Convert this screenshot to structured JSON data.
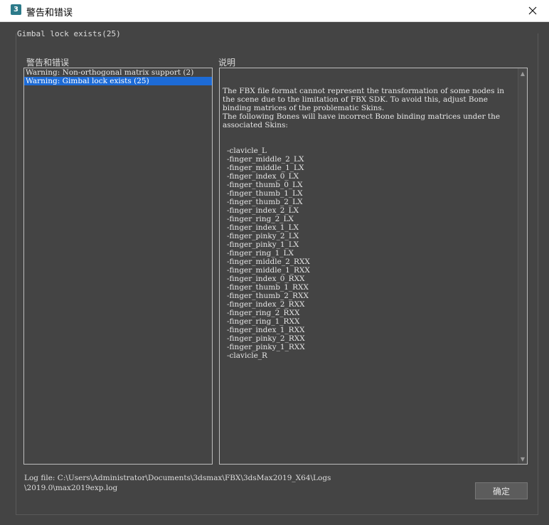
{
  "window": {
    "title": "警告和错误",
    "app_icon_label": "3",
    "close_icon": "close-icon"
  },
  "status_line": "Gimbal lock exists(25)",
  "warnings": {
    "label": "警告和错误",
    "items": [
      {
        "text": "Warning: Non-orthogonal matrix support (2)",
        "selected": false
      },
      {
        "text": "Warning: Gimbal lock exists (25)",
        "selected": true
      }
    ]
  },
  "description": {
    "label": "说明",
    "intro": "The FBX file format cannot represent the transformation of some nodes in the scene due to the limitation of FBX SDK. To avoid this, adjust Bone binding matrices of the problematic Skins.\nThe following Bones will have incorrect Bone binding matrices under the associated Skins:",
    "bones": [
      "-clavicle_L",
      "-finger_middle_2_LX",
      "-finger_middle_1_LX",
      "-finger_index_0_LX",
      "-finger_thumb_0_LX",
      "-finger_thumb_1_LX",
      "-finger_thumb_2_LX",
      "-finger_index_2_LX",
      "-finger_ring_2_LX",
      "-finger_index_1_LX",
      "-finger_pinky_2_LX",
      "-finger_pinky_1_LX",
      "-finger_ring_1_LX",
      "-finger_middle_2_RXX",
      "-finger_middle_1_RXX",
      "-finger_index_0_RXX",
      "-finger_thumb_1_RXX",
      "-finger_thumb_2_RXX",
      "-finger_index_2_RXX",
      "-finger_ring_2_RXX",
      "-finger_ring_1_RXX",
      "-finger_index_1_RXX",
      "-finger_pinky_2_RXX",
      "-finger_pinky_1_RXX",
      "-clavicle_R"
    ]
  },
  "log": {
    "line1": "Log file: C:\\Users\\Administrator\\Documents\\3dsmax\\FBX\\3dsMax2019_X64\\Logs",
    "line2": "\\2019.0\\max2019exp.log"
  },
  "buttons": {
    "ok": "确定"
  },
  "colors": {
    "background": "#444444",
    "selection": "#1d6bd6",
    "titlebar": "#ffffff"
  }
}
